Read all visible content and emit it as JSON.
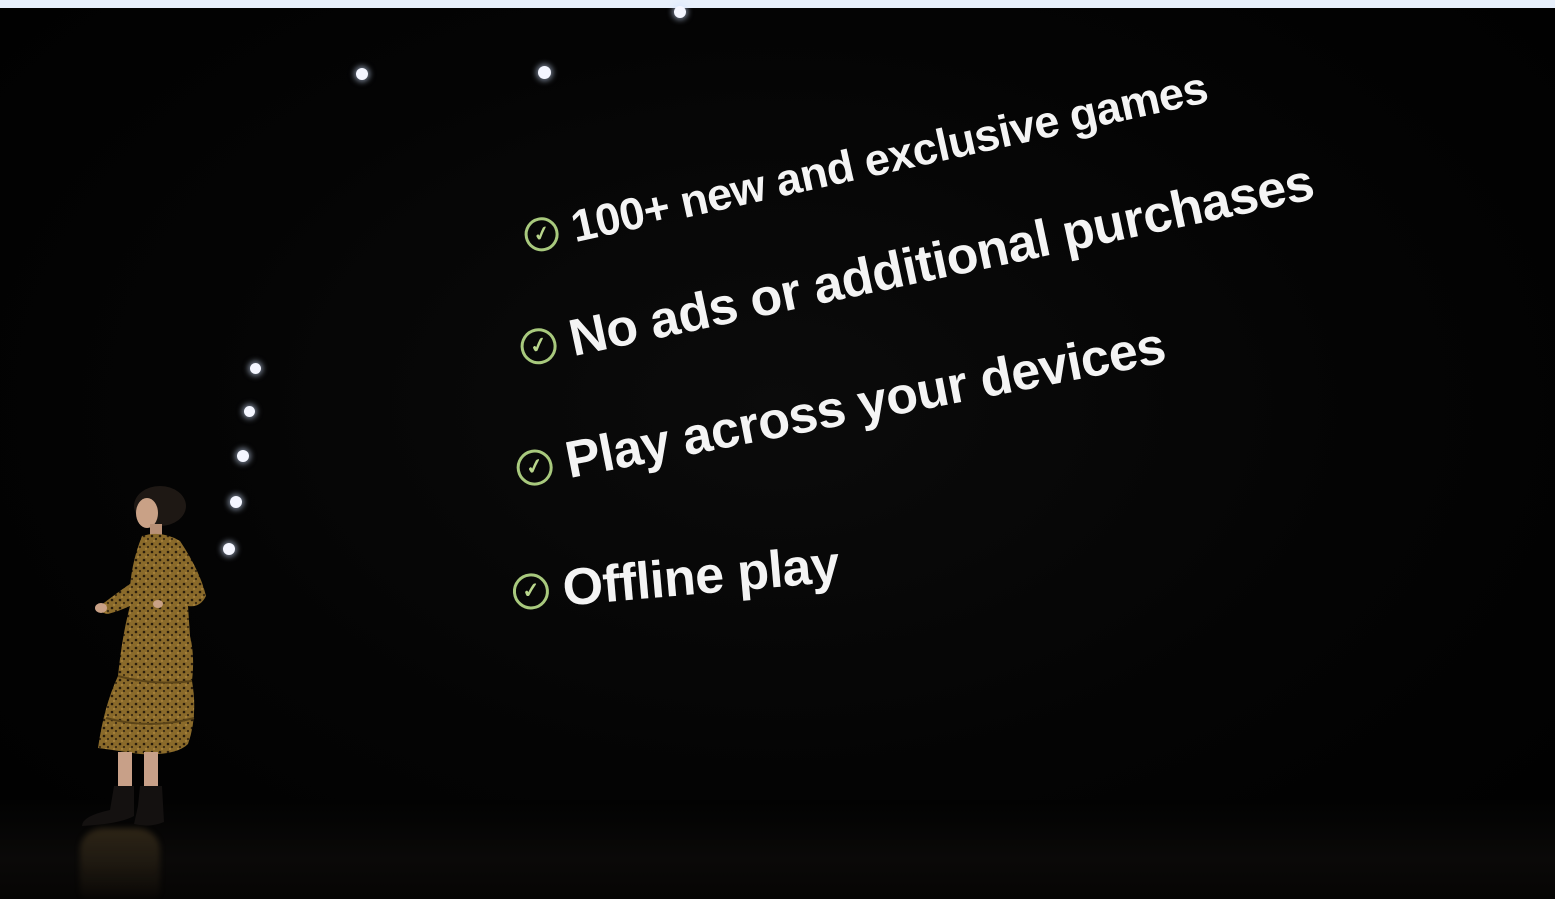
{
  "slide": {
    "features": [
      {
        "label": "100+ new and exclusive games",
        "icon": "check-circle-icon"
      },
      {
        "label": "No ads or additional purchases",
        "icon": "check-circle-icon"
      },
      {
        "label": "Play across your devices",
        "icon": "check-circle-icon"
      },
      {
        "label": "Offline play",
        "icon": "check-circle-icon"
      }
    ],
    "check_glyph": "✓",
    "check_color": "#a8c97d",
    "text_color": "#f4f4f4",
    "background_color": "#000000"
  }
}
